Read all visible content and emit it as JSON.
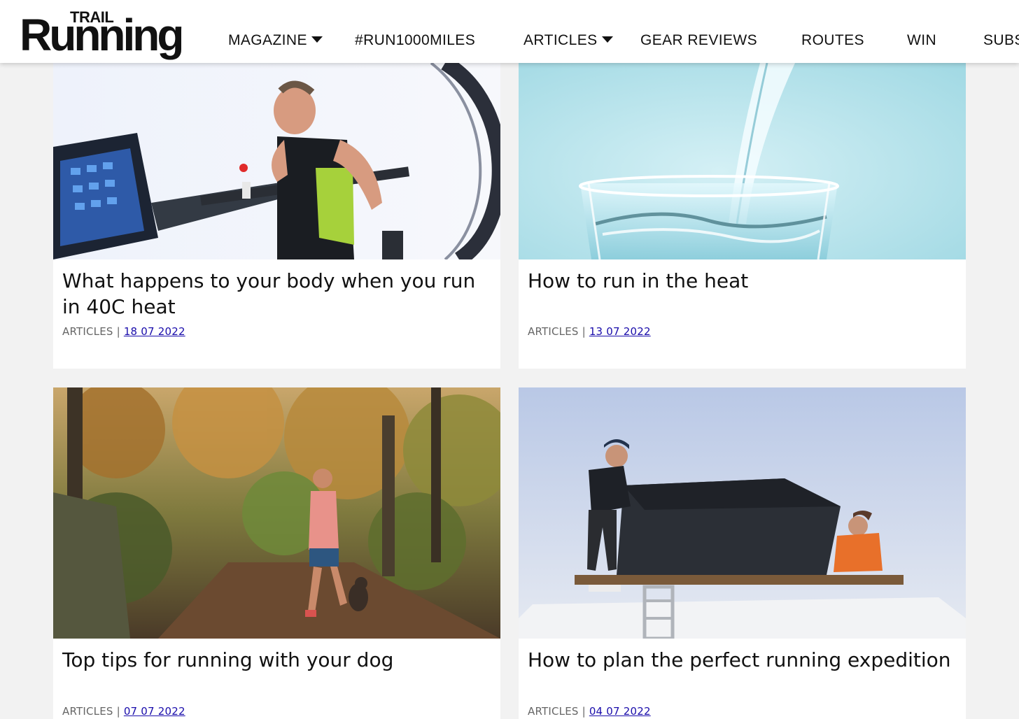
{
  "header": {
    "logo": {
      "top_text": "TRAIL",
      "main_text": "Running"
    },
    "nav": [
      {
        "label": "MAGAZINE",
        "has_dropdown": true
      },
      {
        "label": "#RUN1000MILES",
        "has_dropdown": false
      },
      {
        "label": "ARTICLES",
        "has_dropdown": true
      },
      {
        "label": "GEAR REVIEWS",
        "has_dropdown": false
      },
      {
        "label": "ROUTES",
        "has_dropdown": false
      },
      {
        "label": "WIN",
        "has_dropdown": false
      },
      {
        "label": "SUBS",
        "has_dropdown": false
      }
    ]
  },
  "cards": [
    {
      "title": "What happens to your body when you run in 40C heat",
      "category": "ARTICLES",
      "separator": "|",
      "date": "18 07 2022",
      "image": "treadmill-runner-photo"
    },
    {
      "title": "How to run in the heat",
      "category": "ARTICLES",
      "separator": "|",
      "date": "13 07 2022",
      "image": "water-glass-photo"
    },
    {
      "title": "Top tips for running with your dog",
      "category": "ARTICLES",
      "separator": "|",
      "date": "07 07 2022",
      "image": "trail-runner-with-dog-photo"
    },
    {
      "title": "How to plan the perfect running expedition",
      "category": "ARTICLES",
      "separator": "|",
      "date": "04 07 2022",
      "image": "roof-tent-van-photo"
    }
  ],
  "colors": {
    "background": "#f2f2f2",
    "card": "#ffffff",
    "text": "#111111",
    "meta": "#666666",
    "link": "#1a0dab"
  }
}
